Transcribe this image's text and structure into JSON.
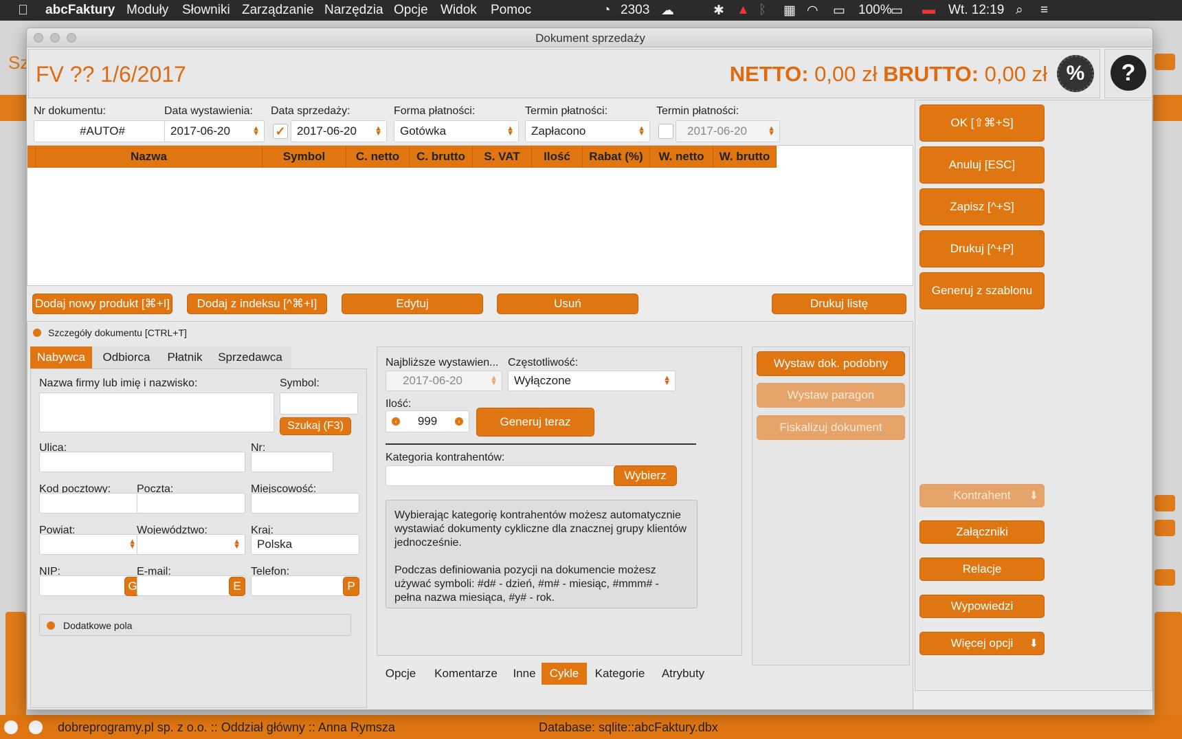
{
  "menubar": {
    "app_name": "abcFaktury",
    "items": [
      "Moduły",
      "Słowniki",
      "Zarządzanie",
      "Narzędzia",
      "Opcje",
      "Widok",
      "Pomoc"
    ],
    "counter": "2303",
    "battery": "100%",
    "clock": "Wt. 12:19"
  },
  "window": {
    "title": "Dokument sprzedaży"
  },
  "header": {
    "doc_number": "FV ?? 1/6/2017",
    "netto_label": "NETTO:",
    "netto_value": "0,00 zł",
    "brutto_label": "BRUTTO:",
    "brutto_value": "0,00 zł",
    "percent_icon": "%",
    "help_icon": "?"
  },
  "form": {
    "nr_label": "Nr dokumentu:",
    "nr_value": "#AUTO#",
    "data_wyst_label": "Data wystawienia:",
    "data_wyst_value": "2017-06-20",
    "data_sprz_label": "Data sprzedaży:",
    "data_sprz_value": "2017-06-20",
    "forma_label": "Forma płatności:",
    "forma_value": "Gotówka",
    "termin1_label": "Termin płatności:",
    "termin1_value": "Zapłacono",
    "termin2_label": "Termin płatności:",
    "termin2_value": "2017-06-20"
  },
  "table": {
    "columns": [
      "Nazwa",
      "Symbol",
      "C. netto",
      "C. brutto",
      "S. VAT",
      "Ilość",
      "Rabat (%)",
      "W. netto",
      "W. brutto"
    ]
  },
  "item_buttons": {
    "add_new": "Dodaj nowy produkt [⌘+I]",
    "add_index": "Dodaj z indeksu [^⌘+I]",
    "edit": "Edytuj",
    "remove": "Usuń",
    "print_list": "Drukuj listę"
  },
  "side_buttons": {
    "ok": "OK [⇧⌘+S]",
    "cancel": "Anuluj [ESC]",
    "save": "Zapisz [^+S]",
    "print": "Drukuj [^+P]",
    "template": "Generuj z szablonu",
    "kontrahent": "Kontrahent",
    "zalaczniki": "Załączniki",
    "relacje": "Relacje",
    "wypowiedzi": "Wypowiedzi",
    "wiecej": "Więcej opcji"
  },
  "details": {
    "toggle_label": "Szczegóły dokumentu [CTRL+T]",
    "tabs": [
      "Nabywca",
      "Odbiorca",
      "Płatnik",
      "Sprzedawca"
    ],
    "active_tab": "Nabywca",
    "nazwa_label": "Nazwa firmy lub imię i nazwisko:",
    "symbol_label": "Symbol:",
    "search_btn": "Szukaj (F3)",
    "ulica_label": "Ulica:",
    "nr_label": "Nr:",
    "kod_label": "Kod pocztowy:",
    "poczta_label": "Poczta:",
    "miejscowosc_label": "Miejscowość:",
    "powiat_label": "Powiat:",
    "wojewodztwo_label": "Województwo:",
    "kraj_label": "Kraj:",
    "kraj_value": "Polska",
    "nip_label": "NIP:",
    "nip_btn": "G",
    "email_label": "E-mail:",
    "email_btn": "E",
    "telefon_label": "Telefon:",
    "telefon_btn": "P",
    "extra_fields": "Dodatkowe pola"
  },
  "cycles": {
    "next_label": "Najbliższe wystawien...",
    "next_value": "2017-06-20",
    "freq_label": "Częstotliwość:",
    "freq_value": "Wyłączone",
    "qty_label": "Ilość:",
    "qty_value": "999",
    "generate_btn": "Generuj teraz",
    "category_label": "Kategoria kontrahentów:",
    "choose_btn": "Wybierz",
    "info_p1": "Wybierając kategorię kontrahentów możesz automatycznie wystawiać dokumenty cykliczne dla znacznej grupy klientów jednocześnie.",
    "info_p2": "Podczas definiowania pozycji na dokumencie możesz używać symboli: #d# - dzień, #m# - miesiąc, #mmm# - pełna nazwa miesiąca, #y# - rok.",
    "tabs": [
      "Opcje",
      "Komentarze",
      "Inne",
      "Cykle",
      "Kategorie",
      "Atrybuty"
    ],
    "active_tab": "Cykle"
  },
  "actions": {
    "similar": "Wystaw dok. podobny",
    "receipt": "Wystaw paragon",
    "fiscal": "Fiskalizuj dokument"
  },
  "status": {
    "left": "dobreprogramy.pl sp. z o.o. :: Oddział główny :: Anna Rymsza",
    "right": "Database: sqlite::abcFaktury.dbx"
  },
  "colors": {
    "accent": "#e07611",
    "menubar": "#2b2b2b"
  }
}
